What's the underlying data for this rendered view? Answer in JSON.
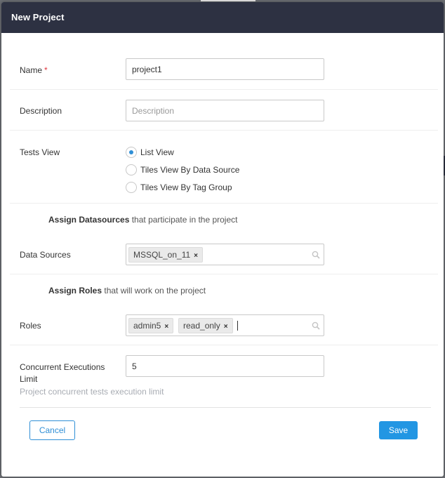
{
  "modal": {
    "title": "New Project"
  },
  "name": {
    "label": "Name",
    "required_mark": "*",
    "value": "project1"
  },
  "description": {
    "label": "Description",
    "placeholder": "Description",
    "value": ""
  },
  "tests_view": {
    "label": "Tests View",
    "options": [
      {
        "label": "List View",
        "checked": true
      },
      {
        "label": "Tiles View By Data Source",
        "checked": false
      },
      {
        "label": "Tiles View By Tag Group",
        "checked": false
      }
    ]
  },
  "datasources": {
    "heading_bold": "Assign Datasources",
    "heading_rest": " that participate in the project",
    "label": "Data Sources",
    "tags": [
      "MSSQL_on_11"
    ],
    "remove_glyph": "×"
  },
  "roles": {
    "heading_bold": "Assign Roles",
    "heading_rest": " that will work on the project",
    "label": "Roles",
    "tags": [
      "admin5",
      "read_only"
    ],
    "remove_glyph": "×"
  },
  "concurrent": {
    "label_line1": "Concurrent Executions",
    "label_line2": "Limit",
    "value": "5",
    "hint": "Project concurrent tests execution limit"
  },
  "footer": {
    "cancel_label": "Cancel",
    "save_label": "Save"
  },
  "colors": {
    "header": "#2d3142",
    "accent": "#2296e3",
    "required": "#e0383f"
  }
}
